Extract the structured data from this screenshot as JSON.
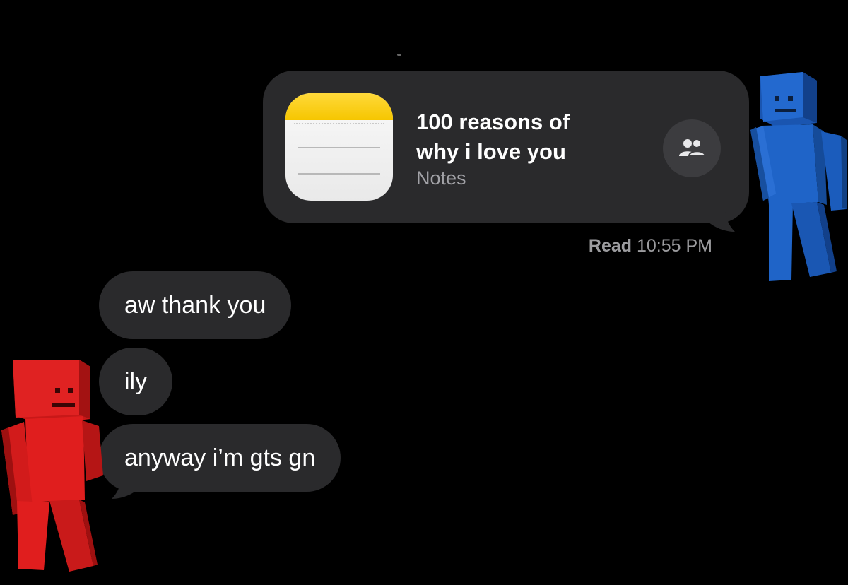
{
  "conversation": {
    "sent_card": {
      "title": "100 reasons of\nwhy i love you",
      "app_name": "Notes",
      "app_icon": "notes-app-icon",
      "action_icon": "people-icon"
    },
    "read_receipt": {
      "status": "Read",
      "time": "10:55 PM"
    },
    "received_messages": [
      {
        "text": "aw thank you"
      },
      {
        "text": "ily"
      },
      {
        "text": "anyway i’m gts gn"
      }
    ]
  },
  "stickers": {
    "blue_figure": {
      "color": "#1f64c8",
      "icon": "blue-blocky-figure"
    },
    "red_figure": {
      "color": "#e01e1e",
      "icon": "red-blocky-figure"
    }
  },
  "colors": {
    "background": "#000000",
    "bubble": "#2a2a2c",
    "secondary_text": "#a2a2a7"
  }
}
